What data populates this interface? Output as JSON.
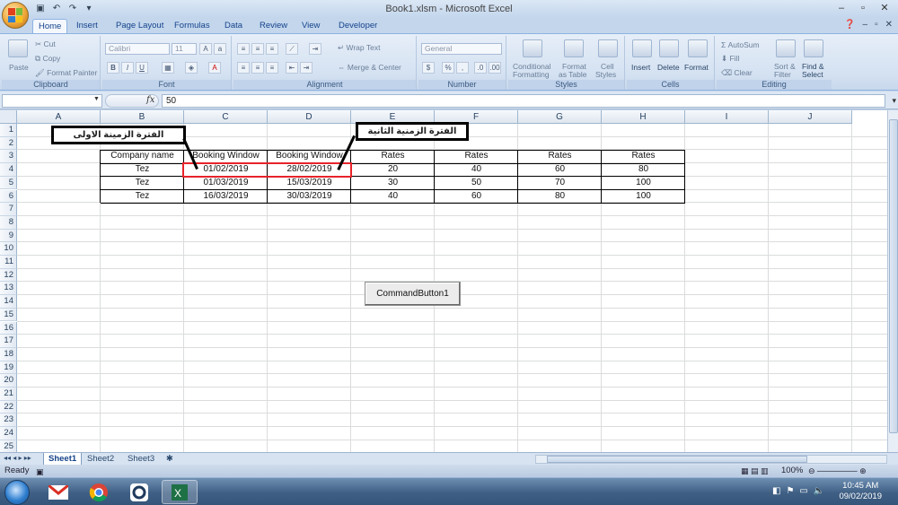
{
  "window": {
    "title": "Book1.xlsm - Microsoft Excel"
  },
  "tabs": [
    "Home",
    "Insert",
    "Page Layout",
    "Formulas",
    "Data",
    "Review",
    "View",
    "Developer"
  ],
  "ribbon": {
    "clipboard": {
      "paste": "Paste",
      "cut": "Cut",
      "copy": "Copy",
      "format_painter": "Format Painter",
      "label": "Clipboard"
    },
    "font": {
      "name": "Calibri",
      "size": "11",
      "bold": "B",
      "italic": "I",
      "underline": "U",
      "label": "Font"
    },
    "alignment": {
      "wrap": "Wrap Text",
      "merge": "Merge & Center",
      "label": "Alignment"
    },
    "number": {
      "format": "General",
      "currency": "$",
      "percent": "%",
      "comma": ",",
      "label": "Number"
    },
    "styles": {
      "conditional": "Conditional",
      "conditional2": "Formatting",
      "format_table": "Format",
      "format_table2": "as Table",
      "cell_styles": "Cell",
      "cell_styles2": "Styles",
      "label": "Styles"
    },
    "cells": {
      "insert": "Insert",
      "delete": "Delete",
      "format": "Format",
      "label": "Cells"
    },
    "editing": {
      "autosum": "AutoSum",
      "fill": "Fill",
      "clear": "Clear",
      "sort": "Sort &",
      "sort2": "Filter",
      "find": "Find &",
      "find2": "Select",
      "label": "Editing"
    }
  },
  "formula_bar": {
    "fx": "fx",
    "value": "50"
  },
  "columns": [
    "A",
    "B",
    "C",
    "D",
    "E",
    "F",
    "G",
    "H",
    "I",
    "J"
  ],
  "rows": [
    "1",
    "2",
    "3",
    "4",
    "5",
    "6",
    "7",
    "8",
    "9",
    "10",
    "11",
    "12",
    "13",
    "14",
    "15",
    "16",
    "17",
    "18",
    "19",
    "20",
    "21",
    "22",
    "23",
    "24",
    "25"
  ],
  "table": {
    "headers": [
      "Company name",
      "Booking Window",
      "Booking Window",
      "Rates",
      "Rates",
      "Rates",
      "Rates"
    ],
    "rows": [
      [
        "Tez",
        "01/02/2019",
        "28/02/2019",
        "20",
        "40",
        "60",
        "80"
      ],
      [
        "Tez",
        "01/03/2019",
        "15/03/2019",
        "30",
        "50",
        "70",
        "100"
      ],
      [
        "Tez",
        "16/03/2019",
        "30/03/2019",
        "40",
        "60",
        "80",
        "100"
      ]
    ]
  },
  "callouts": {
    "first": "الفترة الزمينة الاولى",
    "second": "الفترة الزمنية الثانية"
  },
  "command_button": "CommandButton1",
  "sheets": [
    "Sheet1",
    "Sheet2",
    "Sheet3"
  ],
  "status": {
    "ready": "Ready",
    "zoom": "100%"
  },
  "taskbar": {
    "time": "10:45 AM",
    "date": "09/02/2019"
  },
  "colors": {
    "highlight": "#e8232a",
    "ribbon": "#d5e2f2",
    "taskbar": "#3f5f84"
  }
}
